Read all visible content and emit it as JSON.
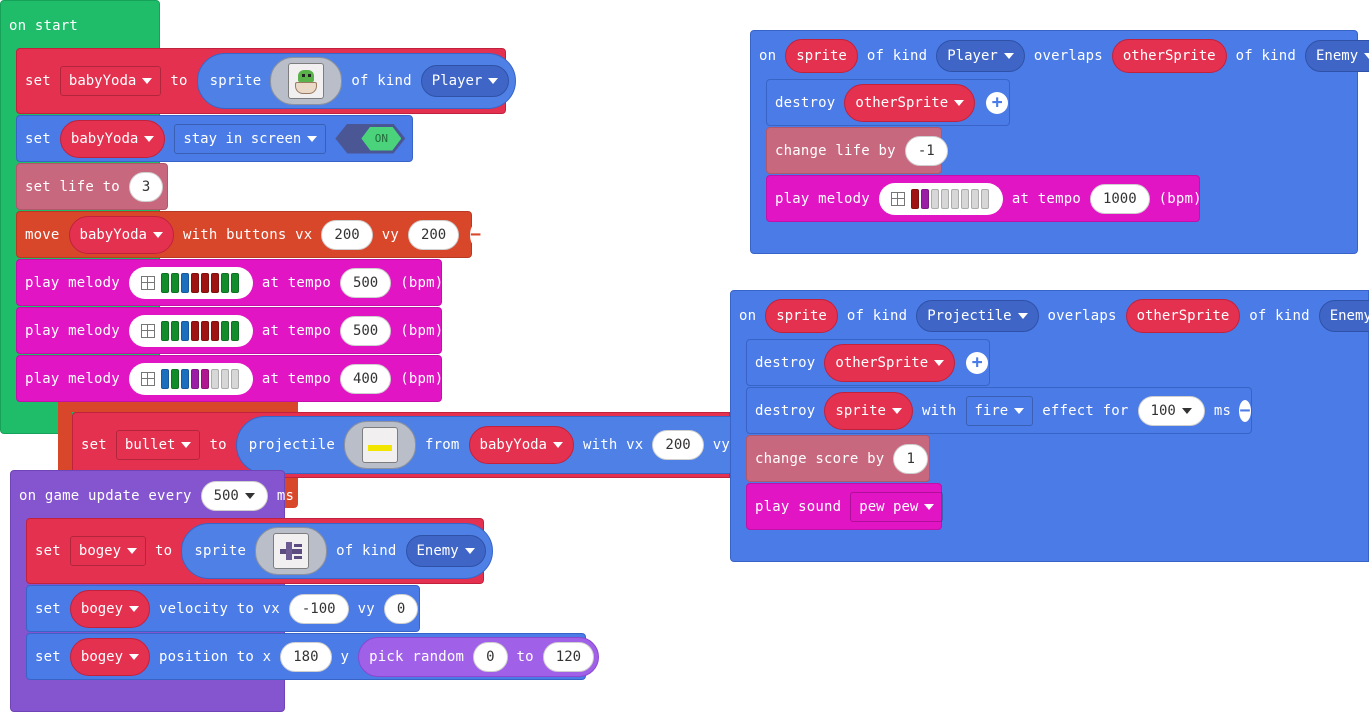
{
  "on_start": {
    "title": "on start",
    "set_sprite": {
      "set": "set",
      "var": "babyYoda",
      "to": "to",
      "sprite": "sprite",
      "of_kind": "of kind",
      "kind": "Player"
    },
    "stay": {
      "set": "set",
      "var": "babyYoda",
      "flag": "stay in screen",
      "toggle": "ON"
    },
    "set_life": {
      "label": "set life to",
      "value": "3"
    },
    "move": {
      "move": "move",
      "var": "babyYoda",
      "with": "with buttons vx",
      "vx": "200",
      "vy_label": "vy",
      "vy": "200"
    },
    "melodies": [
      {
        "play": "play melody",
        "at": "at tempo",
        "tempo": "500",
        "bpm": "(bpm)"
      },
      {
        "play": "play melody",
        "at": "at tempo",
        "tempo": "500",
        "bpm": "(bpm)"
      },
      {
        "play": "play melody",
        "at": "at tempo",
        "tempo": "400",
        "bpm": "(bpm)"
      }
    ]
  },
  "projectile": {
    "set": "set",
    "var": "bullet",
    "to": "to",
    "projectile": "projectile",
    "from": "from",
    "source": "babyYoda",
    "with_vx": "with vx",
    "vx": "200",
    "vy": "vy"
  },
  "game_update": {
    "title_pre": "on game update every",
    "interval": "500",
    "unit": "ms",
    "set_sprite": {
      "set": "set",
      "var": "bogey",
      "to": "to",
      "sprite": "sprite",
      "of_kind": "of kind",
      "kind": "Enemy"
    },
    "velocity": {
      "set": "set",
      "var": "bogey",
      "label": "velocity to vx",
      "vx": "-100",
      "vy_label": "vy",
      "vy": "0"
    },
    "position": {
      "set": "set",
      "var": "bogey",
      "label": "position to x",
      "x": "180",
      "y_label": "y",
      "pick": "pick random",
      "from": "0",
      "to": "to",
      "max": "120"
    }
  },
  "overlap_player": {
    "on": "on",
    "sprite": "sprite",
    "of_kind": "of kind",
    "kind": "Player",
    "overlaps": "overlaps",
    "other": "otherSprite",
    "of_kind2": "of kind",
    "kind2": "Enemy",
    "destroy": {
      "label": "destroy",
      "target": "otherSprite"
    },
    "change_life": {
      "label": "change life by",
      "value": "-1"
    },
    "melody": {
      "play": "play melody",
      "at": "at tempo",
      "tempo": "1000",
      "bpm": "(bpm)"
    }
  },
  "overlap_projectile": {
    "on": "on",
    "sprite": "sprite",
    "of_kind": "of kind",
    "kind": "Projectile",
    "overlaps": "overlaps",
    "other": "otherSprite",
    "of_kind2": "of kind",
    "kind2": "Enemy",
    "destroy": {
      "label": "destroy",
      "target": "otherSprite"
    },
    "destroy_effect": {
      "label": "destroy",
      "target": "sprite",
      "with": "with",
      "effect": "fire",
      "effect_for": "effect for",
      "ms_value": "100",
      "ms": "ms"
    },
    "change_score": {
      "label": "change score by",
      "value": "1"
    },
    "sound": {
      "label": "play sound",
      "sound": "pew pew"
    }
  },
  "colors": {
    "events": "#1fbc69",
    "sprites": "#e4314f",
    "scene": "#4a7be6",
    "info": "#c8687e",
    "music": "#e115c4",
    "controller": "#d9472b",
    "game_loop": "#8554cf"
  },
  "melody_notes": {
    "m1": [
      "#138d2c",
      "#138d2c",
      "#1c6fbf",
      "#a01313",
      "#a01313",
      "#a01313",
      "#138d2c",
      "#138d2c"
    ],
    "m2": [
      "#138d2c",
      "#138d2c",
      "#1c6fbf",
      "#a01313",
      "#a01313",
      "#a01313",
      "#138d2c",
      "#138d2c"
    ],
    "m3": [
      "#1c6fbf",
      "#138d2c",
      "#1c6fbf",
      "#9b1da5",
      "#b0168f",
      "#d7d7d7",
      "#d7d7d7",
      "#d7d7d7"
    ],
    "m4": [
      "#a01313",
      "#9b1da5",
      "#d7d7d7",
      "#d7d7d7",
      "#d7d7d7",
      "#d7d7d7",
      "#d7d7d7",
      "#d7d7d7"
    ]
  }
}
